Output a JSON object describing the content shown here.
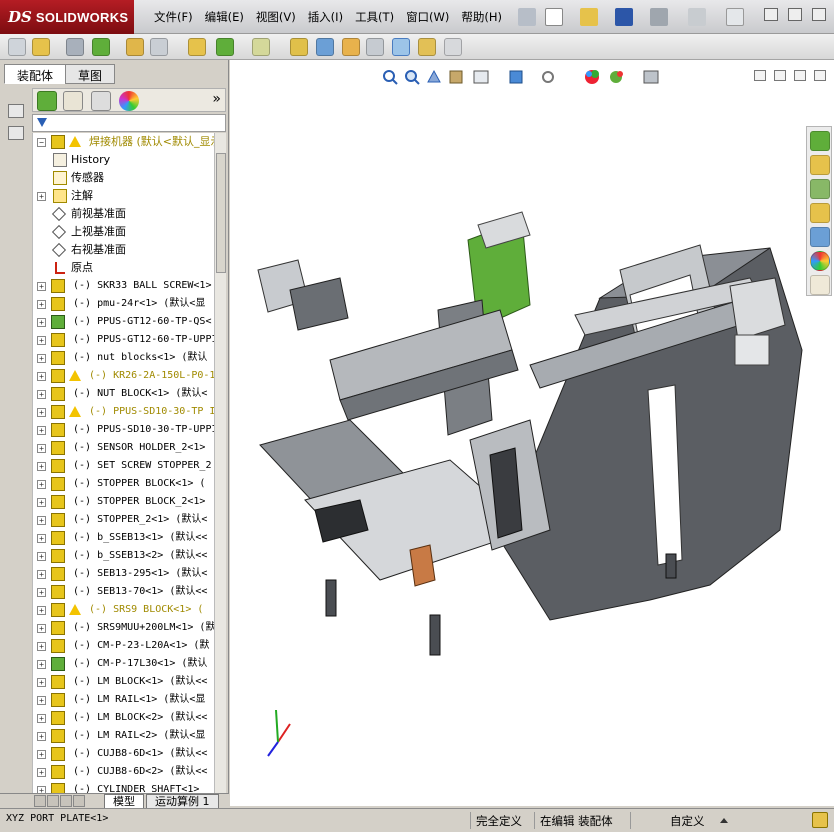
{
  "app": {
    "brand_ds": "DS",
    "brand_name": "SOLIDWORKS"
  },
  "menu": [
    "文件(F)",
    "编辑(E)",
    "视图(V)",
    "插入(I)",
    "工具(T)",
    "窗口(W)",
    "帮助(H)"
  ],
  "panel": {
    "tabs": [
      "装配体",
      "草图"
    ],
    "expand_glyph": "»",
    "filter_icon": "filter-icon"
  },
  "tree": {
    "root": "焊接机器  (默认<默认_显示",
    "aux": [
      "History",
      "传感器",
      "注解",
      "前视基准面",
      "上视基准面",
      "右视基准面",
      "原点"
    ],
    "components": [
      {
        "label": "(-) SKR33 BALL SCREW<1>",
        "warn": false
      },
      {
        "label": "(-) pmu-24r<1> (默认<显",
        "warn": false
      },
      {
        "label": "(-) PPUS-GT12-60-TP-QS<",
        "warn": false
      },
      {
        "label": "(-) PPUS-GT12-60-TP-UPPI",
        "warn": false
      },
      {
        "label": "(-) nut blocks<1> (默认",
        "warn": false
      },
      {
        "label": "(-) KR26-2A-150L-P0-1",
        "warn": true
      },
      {
        "label": "(-) NUT BLOCK<1> (默认<",
        "warn": false
      },
      {
        "label": "(-) PPUS-SD10-30-TP I",
        "warn": true
      },
      {
        "label": "(-) PPUS-SD10-30-TP-UPPI",
        "warn": false
      },
      {
        "label": "(-) SENSOR HOLDER_2<1>",
        "warn": false
      },
      {
        "label": "(-) SET SCREW STOPPER_2",
        "warn": false
      },
      {
        "label": "(-) STOPPER BLOCK<1> (",
        "warn": false
      },
      {
        "label": "(-) STOPPER BLOCK_2<1>",
        "warn": false
      },
      {
        "label": "(-) STOPPER_2<1> (默认<",
        "warn": false
      },
      {
        "label": "(-) b_SSEB13<1> (默认<<",
        "warn": false
      },
      {
        "label": "(-) b_SSEB13<2> (默认<<",
        "warn": false
      },
      {
        "label": "(-) SEB13-295<1> (默认<",
        "warn": false
      },
      {
        "label": "(-) SEB13-70<1> (默认<<",
        "warn": false
      },
      {
        "label": "(-) SRS9 BLOCK<1> (",
        "warn": true
      },
      {
        "label": "(-) SRS9MUU+200LM<1> (默",
        "warn": false
      },
      {
        "label": "(-) CM-P-23-L20A<1> (默",
        "warn": false
      },
      {
        "label": "(-) CM-P-17L30<1> (默认",
        "warn": false
      },
      {
        "label": "(-) LM BLOCK<1> (默认<<",
        "warn": false
      },
      {
        "label": "(-) LM RAIL<1> (默认<显",
        "warn": false
      },
      {
        "label": "(-) LM BLOCK<2> (默认<<",
        "warn": false
      },
      {
        "label": "(-) LM RAIL<2> (默认<显",
        "warn": false
      },
      {
        "label": "(-) CUJB8-6D<1> (默认<<",
        "warn": false
      },
      {
        "label": "(-) CUJB8-6D<2> (默认<<",
        "warn": false
      },
      {
        "label": "(-) CYLINDER SHAFT<1>",
        "warn": false
      }
    ]
  },
  "bottom_tabs": [
    "模型",
    "运动算例 1"
  ],
  "status": {
    "selection": "XYZ PORT PLATE<1>",
    "definition": "完全定义",
    "mode": "在编辑 装配体",
    "custom": "自定义"
  },
  "colors": {
    "accent": "#b51d24",
    "warning": "#f3c300",
    "component_yellow": "#e7c51b",
    "component_green": "#5fae3a"
  }
}
